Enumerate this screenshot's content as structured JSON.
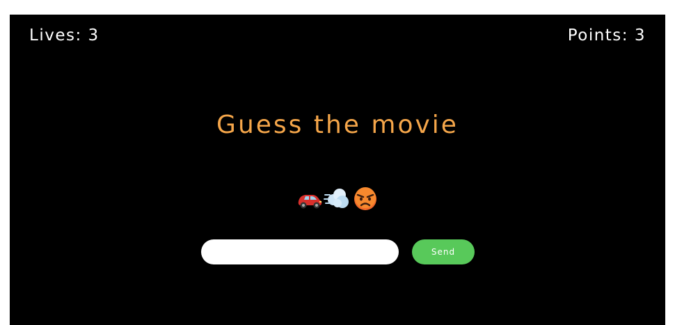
{
  "hud": {
    "lives_text": "Lives: 3",
    "points_text": "Points: 3"
  },
  "title": "Guess the movie",
  "clue": {
    "emojis": [
      "red-car",
      "dashing-away",
      "angry-face"
    ]
  },
  "answer": {
    "value": "",
    "placeholder": ""
  },
  "send_label": "Send",
  "colors": {
    "background": "#000000",
    "title": "#f5a64a",
    "send_button": "#58c95a",
    "text": "#ffffff"
  }
}
